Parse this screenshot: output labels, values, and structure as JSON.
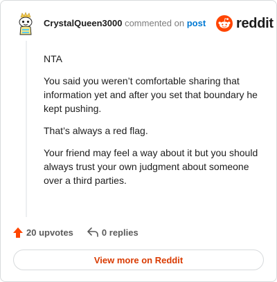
{
  "comment": {
    "username": "CrystalQueen3000",
    "commented_on": "commented on",
    "post_link": "post",
    "avatar_icon": "snoo-avatar-icon",
    "paragraphs": [
      "NTA",
      "You said you weren’t comfortable sharing that information yet and after you set that boundary he kept pushing.",
      "That’s always a red flag.",
      "Your friend may feel a way about it but you should always trust your own judgment about someone over a third parties."
    ],
    "upvotes": "20 upvotes",
    "replies": "0 replies"
  },
  "brand": {
    "name": "reddit",
    "accent": "#ff4500"
  },
  "footer": {
    "view_more": "View more on Reddit"
  },
  "colors": {
    "link": "#0079d3",
    "cta": "#d93a00",
    "muted": "#7c7c7c"
  }
}
